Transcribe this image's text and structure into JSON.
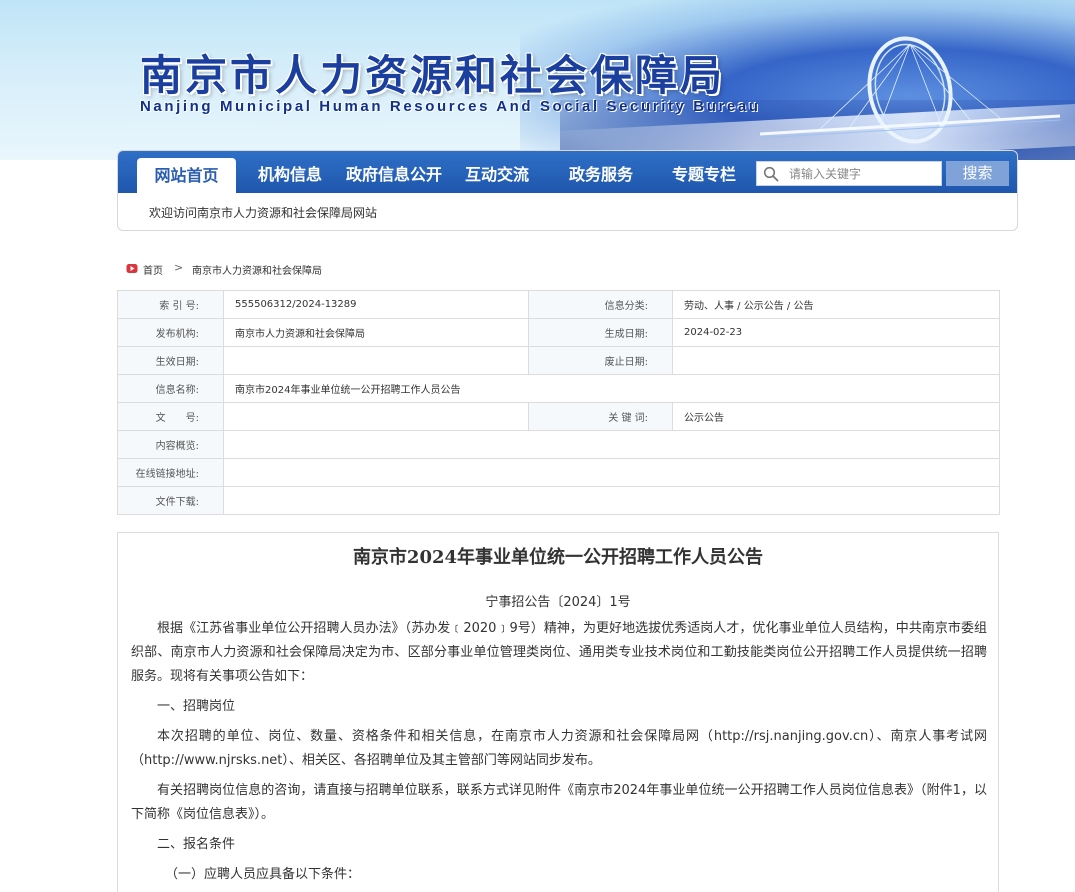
{
  "banner": {
    "title": "南京市人力资源和社会保障局",
    "subtitle": "Nanjing Municipal Human Resources And Social Security Bureau"
  },
  "nav": {
    "items": [
      {
        "label": "网站首页",
        "active": true
      },
      {
        "label": "机构信息",
        "active": false
      },
      {
        "label": "政府信息公开",
        "active": false
      },
      {
        "label": "互动交流",
        "active": false
      },
      {
        "label": "政务服务",
        "active": false
      },
      {
        "label": "专题专栏",
        "active": false
      }
    ],
    "search_placeholder": "请输入关键字",
    "search_button": "搜索",
    "welcome": "欢迎访问南京市人力资源和社会保障局网站"
  },
  "breadcrumb": {
    "home": "首页",
    "separator": ">",
    "current": "南京市人力资源和社会保障局"
  },
  "meta": {
    "index_label": "索 引 号:",
    "index_value": "555506312/2024-13289",
    "category_label": "信息分类:",
    "category_value": "劳动、人事 / 公示公告 / 公告",
    "publisher_label": "发布机构:",
    "publisher_value": "南京市人力资源和社会保障局",
    "created_label": "生成日期:",
    "created_value": "2024-02-23",
    "effective_label": "生效日期:",
    "effective_value": "",
    "expire_label": "废止日期:",
    "expire_value": "",
    "name_label": "信息名称:",
    "name_value": "南京市2024年事业单位统一公开招聘工作人员公告",
    "docno_label": "文　　号:",
    "docno_value": "",
    "keyword_label": "关 键 词:",
    "keyword_value": "公示公告",
    "summary_label": "内容概览:",
    "summary_value": "",
    "link_label": "在线链接地址:",
    "link_value": "",
    "download_label": "文件下载:",
    "download_value": ""
  },
  "article": {
    "title": "南京市2024年事业单位统一公开招聘工作人员公告",
    "doc_number": "宁事招公告〔2024〕1号",
    "paragraphs": [
      "根据《江苏省事业单位公开招聘人员办法》（苏办发﹝2020﹞9号）精神，为更好地选拔优秀适岗人才，优化事业单位人员结构，中共南京市委组织部、南京市人力资源和社会保障局决定为市、区部分事业单位管理类岗位、通用类专业技术岗位和工勤技能类岗位公开招聘工作人员提供统一招聘服务。现将有关事项公告如下：",
      "一、招聘岗位",
      "本次招聘的单位、岗位、数量、资格条件和相关信息，在南京市人力资源和社会保障局网（http://rsj.nanjing.gov.cn）、南京人事考试网（http://www.njrsks.net）、相关区、各招聘单位及其主管部门等网站同步发布。",
      "有关招聘岗位信息的咨询，请直接与招聘单位联系，联系方式详见附件《南京市2024年事业单位统一公开招聘工作人员岗位信息表》（附件1，以下简称《岗位信息表》）。",
      "二、报名条件",
      "（一）应聘人员应具备以下条件："
    ]
  },
  "colors": {
    "nav_blue": "#2a62b8",
    "title_blue": "#1a3f9e",
    "search_button": "#7fa3d9",
    "home_icon_red": "#d9363e"
  },
  "icons": [
    "search-icon",
    "home-icon",
    "bridge-illustration"
  ]
}
